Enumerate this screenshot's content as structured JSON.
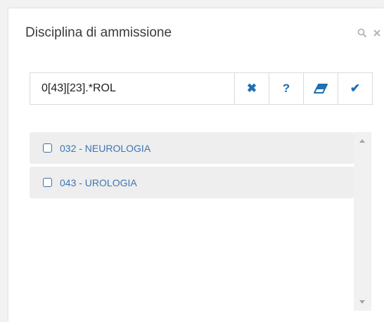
{
  "dialog": {
    "title": "Disciplina di ammissione",
    "icons": [
      "search-icon",
      "close-icon"
    ]
  },
  "search": {
    "value": "0[43][23].*ROL",
    "buttons": [
      {
        "name": "clear",
        "icon": "x-icon",
        "glyph": "✖"
      },
      {
        "name": "help",
        "icon": "question-icon",
        "glyph": "?"
      },
      {
        "name": "eraser",
        "icon": "eraser-icon"
      },
      {
        "name": "confirm",
        "icon": "check-icon",
        "glyph": "✔"
      }
    ]
  },
  "list": {
    "items": [
      {
        "label": "032 - NEUROLOGIA",
        "checked": false
      },
      {
        "label": "043 - UROLOGIA",
        "checked": false
      }
    ]
  },
  "colors": {
    "accent": "#1e6fb3",
    "link": "#3b76b5",
    "item_bg": "#eeeeee"
  }
}
